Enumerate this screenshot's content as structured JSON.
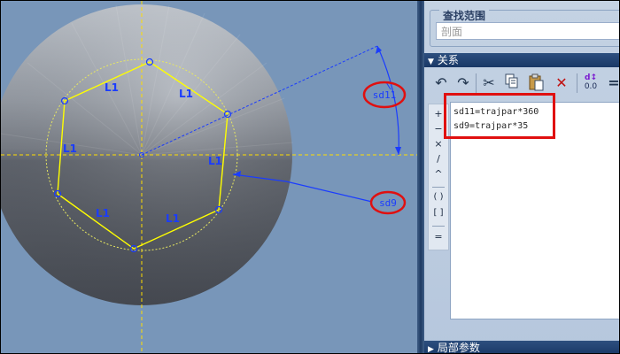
{
  "viewport": {
    "annotations": {
      "sd11_label": "sd11",
      "sd9_label": "sd9"
    },
    "segment_labels": [
      "L1",
      "L1",
      "L1",
      "L1",
      "L1",
      "L1"
    ],
    "colors": {
      "background": "#7896b9",
      "sketch": "#ffff00",
      "dimension": "#1a3cff",
      "centerline": "#ffdd00",
      "highlight": "#e01010"
    }
  },
  "panel": {
    "search_range": {
      "title": "查找范围",
      "value": "剖面"
    },
    "relations_header": "关系",
    "toolbar": {
      "items": [
        "undo-icon",
        "redo-icon",
        "cut-icon",
        "copy-icon",
        "paste-icon",
        "delete-icon",
        "sd-value-icon"
      ],
      "sd_icon_value": "0.0"
    },
    "operators": [
      "+",
      "−",
      "×",
      "/",
      "^",
      "( )",
      "[ ]",
      "="
    ],
    "relations": [
      "sd11=trajpar*360",
      "sd9=trajpar*35"
    ],
    "local_params_header": "局部参数"
  }
}
